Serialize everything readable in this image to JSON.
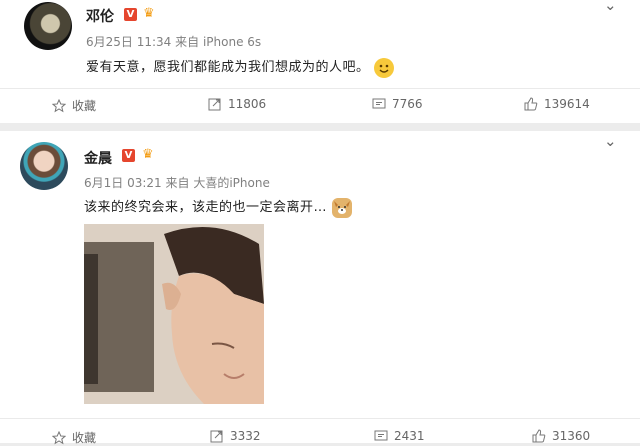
{
  "posts": [
    {
      "author": "邓伦",
      "badge": "V",
      "timestamp": "6月25日 11:34",
      "source": "来自 iPhone 6s",
      "text": "爱有天意，愿我们都能成为我们想成为的人吧。",
      "emoji_icon": "smile-emoji-icon",
      "actions": {
        "favorite": "收藏",
        "repost": "11806",
        "comment": "7766",
        "like": "139614"
      }
    },
    {
      "author": "金晨",
      "badge": "V",
      "timestamp": "6月1日 03:21",
      "source": "来自 大喜的iPhone",
      "text": "该来的终究会来，该走的也一定会离开…",
      "emoji_icon": "dog-emoji-icon",
      "actions": {
        "favorite": "收藏",
        "repost": "3332",
        "comment": "2431",
        "like": "31360"
      }
    }
  ],
  "colors": {
    "badge": "#e5462e",
    "crown": "#f39c12",
    "meta": "#808080",
    "emoji": "#f7c93b",
    "background": "#ececec"
  }
}
